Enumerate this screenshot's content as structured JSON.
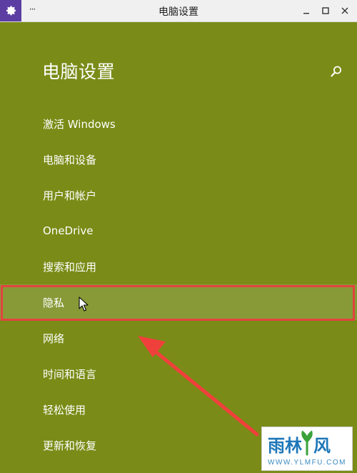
{
  "window": {
    "title": "电脑设置",
    "more_label": "···"
  },
  "header": {
    "title": "电脑设置"
  },
  "nav": {
    "items": [
      {
        "label": "激活 Windows"
      },
      {
        "label": "电脑和设备"
      },
      {
        "label": "用户和帐户"
      },
      {
        "label": "OneDrive"
      },
      {
        "label": "搜索和应用"
      },
      {
        "label": "隐私"
      },
      {
        "label": "网络"
      },
      {
        "label": "时间和语言"
      },
      {
        "label": "轻松使用"
      },
      {
        "label": "更新和恢复"
      }
    ],
    "highlighted_index": 5
  },
  "watermark": {
    "logo_text": "雨林木风",
    "url": "WWW.YLMFU.COM"
  },
  "colors": {
    "background": "#7a8c17",
    "hover": "#889a38",
    "highlight_border": "#e2433f",
    "app_icon": "#5c3ea3"
  }
}
